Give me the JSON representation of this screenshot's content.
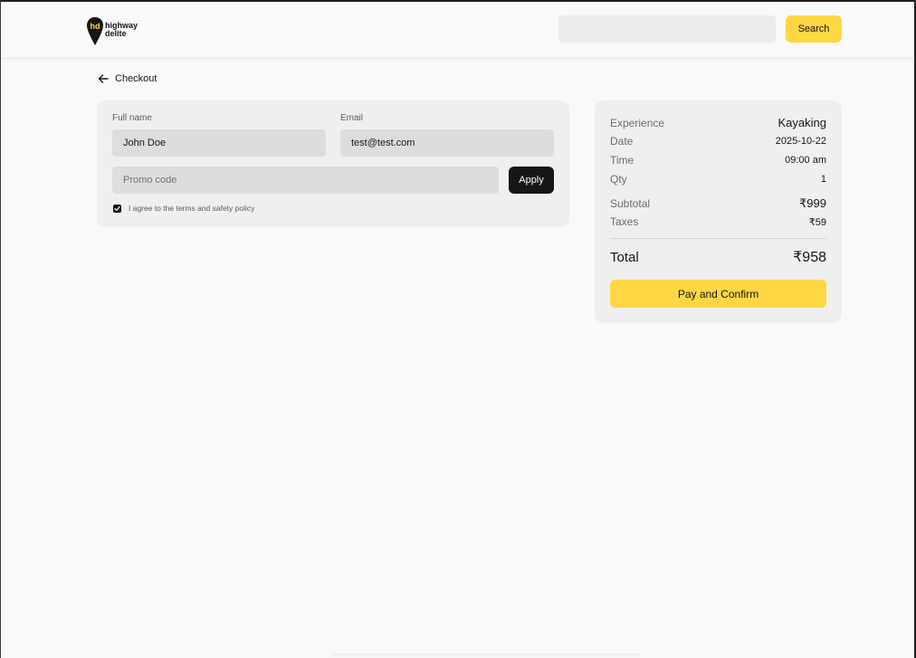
{
  "brand": {
    "name_line1": "highway",
    "name_line2": "delite",
    "accent_color": "#ffd643"
  },
  "search": {
    "value": "",
    "placeholder": "",
    "button_label": "Search"
  },
  "nav": {
    "back_label": "Checkout",
    "back_icon": "arrow-left-icon"
  },
  "form": {
    "full_name": {
      "label": "Full name",
      "value": "John Doe"
    },
    "email": {
      "label": "Email",
      "value": "test@test.com"
    },
    "promo": {
      "placeholder": "Promo code",
      "value": ""
    },
    "apply_label": "Apply",
    "agree": {
      "checked": true,
      "label": "I agree to the terms and safety policy"
    }
  },
  "summary": {
    "experience": {
      "label": "Experience",
      "value": "Kayaking"
    },
    "date": {
      "label": "Date",
      "value": "2025-10-22"
    },
    "time": {
      "label": "Time",
      "value": "09:00 am"
    },
    "qty": {
      "label": "Qty",
      "value": "1"
    },
    "subtotal": {
      "label": "Subtotal",
      "value": "₹999"
    },
    "taxes": {
      "label": "Taxes",
      "value": "₹59"
    },
    "total": {
      "label": "Total",
      "value": "₹958"
    },
    "pay_label": "Pay and Confirm"
  }
}
